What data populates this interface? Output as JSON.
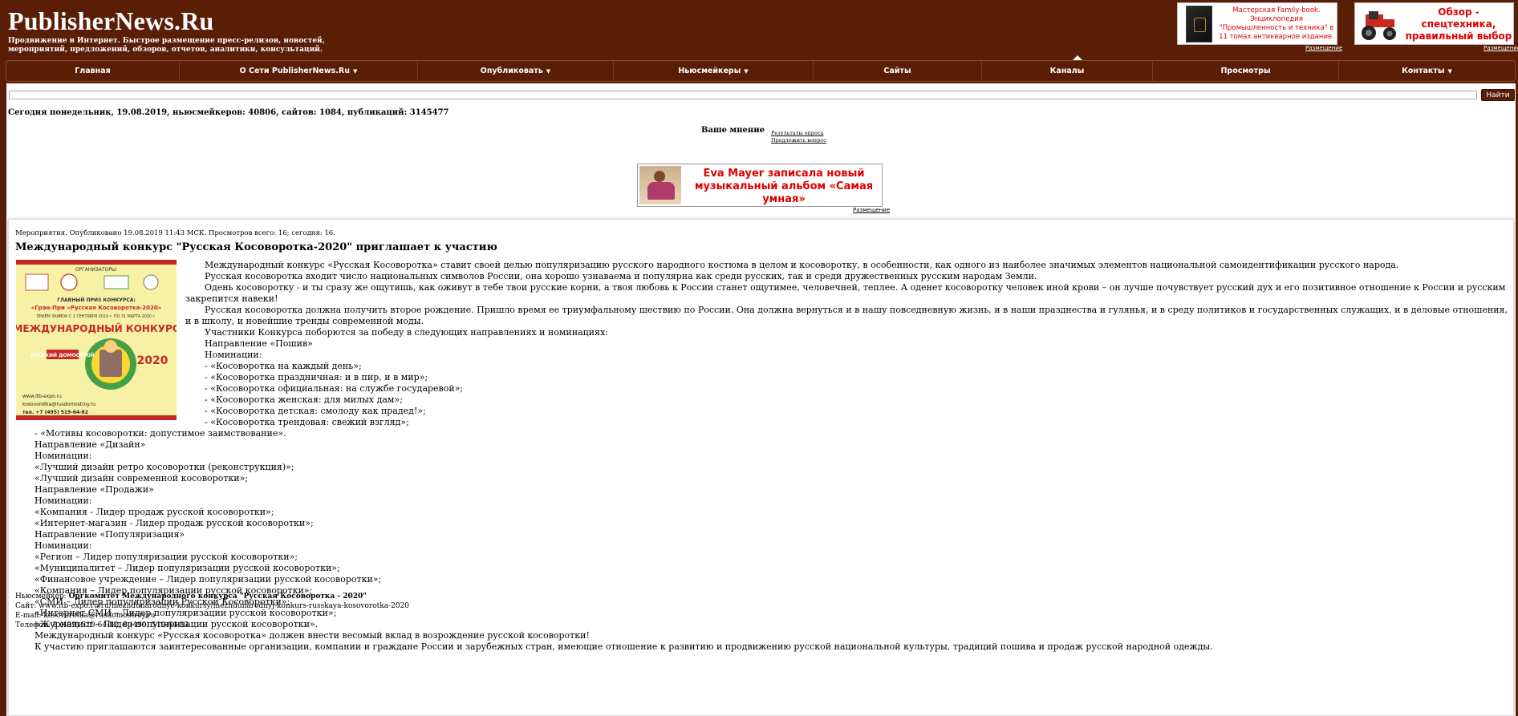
{
  "header": {
    "logo": "PublisherNews.Ru",
    "tagline": "Продвижение в Интернет. Быстрое размещение пресс-релизов, новостей, мероприятий, предложений, обзоров, отчетов, аналитики, консультаций.",
    "ad1_text": "Мастерская Family-book. Энциклопедия \"Промышленность и техника\" в 11 томах антикварное издание.",
    "ad2_text": "Обзор - спецтехника, правильный выбор запчастей",
    "placement_label": "Размещение"
  },
  "nav": {
    "items": [
      {
        "label": "Главная",
        "dropdown": false
      },
      {
        "label": "О Сети PublisherNews.Ru",
        "dropdown": true
      },
      {
        "label": "Опубликовать",
        "dropdown": true
      },
      {
        "label": "Ньюсмейкеры",
        "dropdown": true
      },
      {
        "label": "Сайты",
        "dropdown": false
      },
      {
        "label": "Каналы",
        "dropdown": false
      },
      {
        "label": "Просмотры",
        "dropdown": false
      },
      {
        "label": "Контакты",
        "dropdown": true
      }
    ]
  },
  "search": {
    "value": "",
    "button_label": "Найти"
  },
  "today": "Сегодня понедельник, 19.08.2019, ньюсмейкеров: 40806, сайтов: 1084, публикаций: 3145477",
  "poll": {
    "title": "Ваше мнение",
    "link1": "Результаты опроса",
    "link2": "Предложить вопрос"
  },
  "banner": {
    "text": "Eva Mayer записала новый музыкальный альбом «Самая умная»",
    "placement": "Размещение"
  },
  "article": {
    "meta": "Мероприятия. Опубликовано 19.08.2019 11:43 МСК.  Просмотров всего: 16; сегодня: 16.",
    "title": "Международный конкурс \"Русская Косоворотка-2020\" приглашает к участию",
    "poster": {
      "organizers": "ОРГАНИЗАТОРЫ:",
      "prize": "ГЛАВНЫЙ ПРИЗ КОНКУРСА:",
      "prize_name": "«Гран-При «Русская Косоворотка-2020»",
      "dates": "ПРИЁМ ЗАЯВОК С 1 СЕНТЯБРЯ 2019 г. ПО 31 МАРТА 2020 г.",
      "headline": "МЕЖДУНАРОДНЫЙ КОНКУРС",
      "year": "2020",
      "url": "www.itb-expo.ru",
      "email": "kosovorotka@rusdomostroy.ru",
      "phone": "тел. +7 (495) 519-64-82"
    },
    "paragraphs": [
      "Международный конкурс «Русская Косоворотка» ставит своей целью популяризацию русского народного костюма в целом и косоворотку, в особенности, как одного из наиболее значимых элементов национальной самоидентификации русского народа.",
      "Русская косоворотка входит число национальных символов России, она хорошо узнаваема и популярна как среди русских, так и среди дружественных русским народам Земли.",
      "Одень косоворотку - и ты сразу же ощутишь, как оживут в тебе твои русские корни, а твоя любовь к России станет ощутимее, человечней, теплее. А оденет косоворотку человек иной крови – он лучше почувствует русский дух и его позитивное отношение к России и русским закрепится навеки!",
      "Русская косоворотка должна получить второе рождение. Пришло время ее триумфальному шествию по России. Она должна вернуться и в нашу повседневную жизнь, и в наши празднества и гулянья, и в среду политиков и государственных служащих, и в деловые отношения, и в школу, и новейшие тренды современной моды.",
      "Участники Конкурса поборются за победу в следующих направлениях и номинациях:",
      "Направление «Пошив»",
      "Номинации:",
      "- «Косоворотка на каждый день»;",
      "- «Косоворотка праздничная: и в пир, и в мир»;",
      "- «Косоворотка официальная: на службе государевой»;",
      "- «Косоворотка женская: для милых дам»;",
      "- «Косоворотка детская: смолоду как прадед!»;",
      "- «Косоворотка трендовая: свежий взгляд»;",
      "- «Мотивы косоворотки: допустимое заимствование».",
      "Направление «Дизайн»",
      "Номинации:",
      "«Лучший дизайн ретро косоворотки (реконструкция)»;",
      "«Лучший дизайн современной косоворотки»;",
      "Направление «Продажи»",
      "Номинации:",
      "«Компания - Лидер продаж русской косоворотки»;",
      "«Интернет-магазин - Лидер продаж русской косоворотки»;",
      "Направление «Популяризация»",
      "Номинации:",
      "«Регион – Лидер популяризации русской косоворотки»;",
      "«Муниципалитет – Лидер популяризации русской косоворотки»;",
      "«Финансовое учреждение – Лидер популяризации русской косоворотки»;",
      "«Компания – Лидер популяризации русской косоворотки»;",
      "«СМИ – Лидер популяризации Русской Косоворотки»;",
      "«Интернет СМИ – Лидер популяризации русской косоворотки»;",
      "«Журналист – Лидер популяризации русской косоворотки».",
      "Международный конкурс «Русская косоворотка» должен внести весомый вклад в возрождение русской косоворотки!",
      "К участию приглашаются заинтересованные организации, компании и граждане России и зарубежных стран, имеющие отношение к развитию и продвижению русской национальной культуры, традиций пошива и продаж русской народной одежды."
    ],
    "contact": {
      "newsmaker_label": "Ньюсмейкер:",
      "newsmaker_name": "Оргкомитет Международного конкурса \"Русская Косоворотка - 2020\"",
      "site": "Сайт: www.itb-expo.ru/ru/mezhdunarodnye-konkursy/mezhdunarodnyj-konkurs-russkaya-kosovorotka-2020",
      "email": "E-mail: kosovorotka@rusdomostroy.ru",
      "phone": "Телефон: 8 (499) 519-64-82, 8 (499) 519-64-83"
    }
  },
  "colors": {
    "brand_brown": "#5a1d06",
    "ad_red": "#dd0000",
    "poster_yellow": "#f6f1a4"
  }
}
